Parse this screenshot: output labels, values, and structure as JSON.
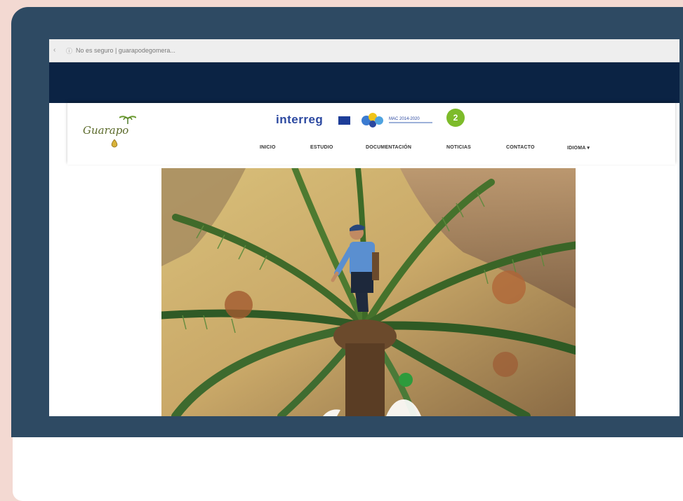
{
  "browser": {
    "url": "No es seguro | guarapodegomera..."
  },
  "site": {
    "logo_text": "Guarapo",
    "brand": "interreg",
    "partner_text": "MAC 2014-2020",
    "badge": "2"
  },
  "nav": [
    {
      "label": "INICIO"
    },
    {
      "label": "ESTUDIO"
    },
    {
      "label": "DOCUMENTACIÓN"
    },
    {
      "label": "NOTICIAS"
    },
    {
      "label": "CONTACTO"
    },
    {
      "label": "IDIOMA ▾"
    }
  ],
  "colors": {
    "frame": "#2e4a63",
    "page_background": "#f3d9d2",
    "dark_band": "#0b2344",
    "accent_green": "#7dbb2a",
    "interreg_blue": "#2b48a0"
  }
}
